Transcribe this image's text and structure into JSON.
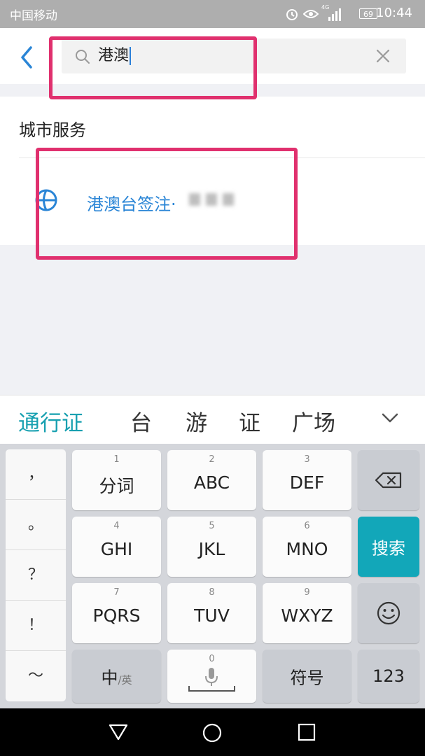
{
  "status_bar": {
    "carrier": "中国移动",
    "network": "4G",
    "battery": "69",
    "time": "10:44"
  },
  "search": {
    "value": "港澳",
    "icon": "search-icon",
    "clear_icon": "close-icon",
    "back_icon": "chevron-left-icon"
  },
  "results": {
    "section_title": "城市服务",
    "items": [
      {
        "label": "港澳台签注·",
        "icon": "globe-icon"
      }
    ]
  },
  "candidates": {
    "items": [
      "通行证",
      "台",
      "游",
      "证",
      "广场"
    ],
    "expand_icon": "chevron-down-icon"
  },
  "keyboard": {
    "punctuation": [
      "，",
      "。",
      "？",
      "！",
      "～"
    ],
    "keys": [
      {
        "num": "1",
        "label": "分词"
      },
      {
        "num": "2",
        "label": "ABC"
      },
      {
        "num": "3",
        "label": "DEF"
      },
      {
        "num": "4",
        "label": "GHI"
      },
      {
        "num": "5",
        "label": "JKL"
      },
      {
        "num": "6",
        "label": "MNO"
      },
      {
        "num": "7",
        "label": "PQRS"
      },
      {
        "num": "8",
        "label": "TUV"
      },
      {
        "num": "9",
        "label": "WXYZ"
      }
    ],
    "search_key": "搜索",
    "lang_key": "中",
    "lang_key_sub": "/英",
    "space_num": "0",
    "symbol_key": "符号",
    "numeric_key": "123"
  },
  "colors": {
    "accent": "#2a85d6",
    "candidate_highlight": "#17a0b0",
    "search_key": "#12a7b9",
    "annotation": "#e0306e"
  }
}
